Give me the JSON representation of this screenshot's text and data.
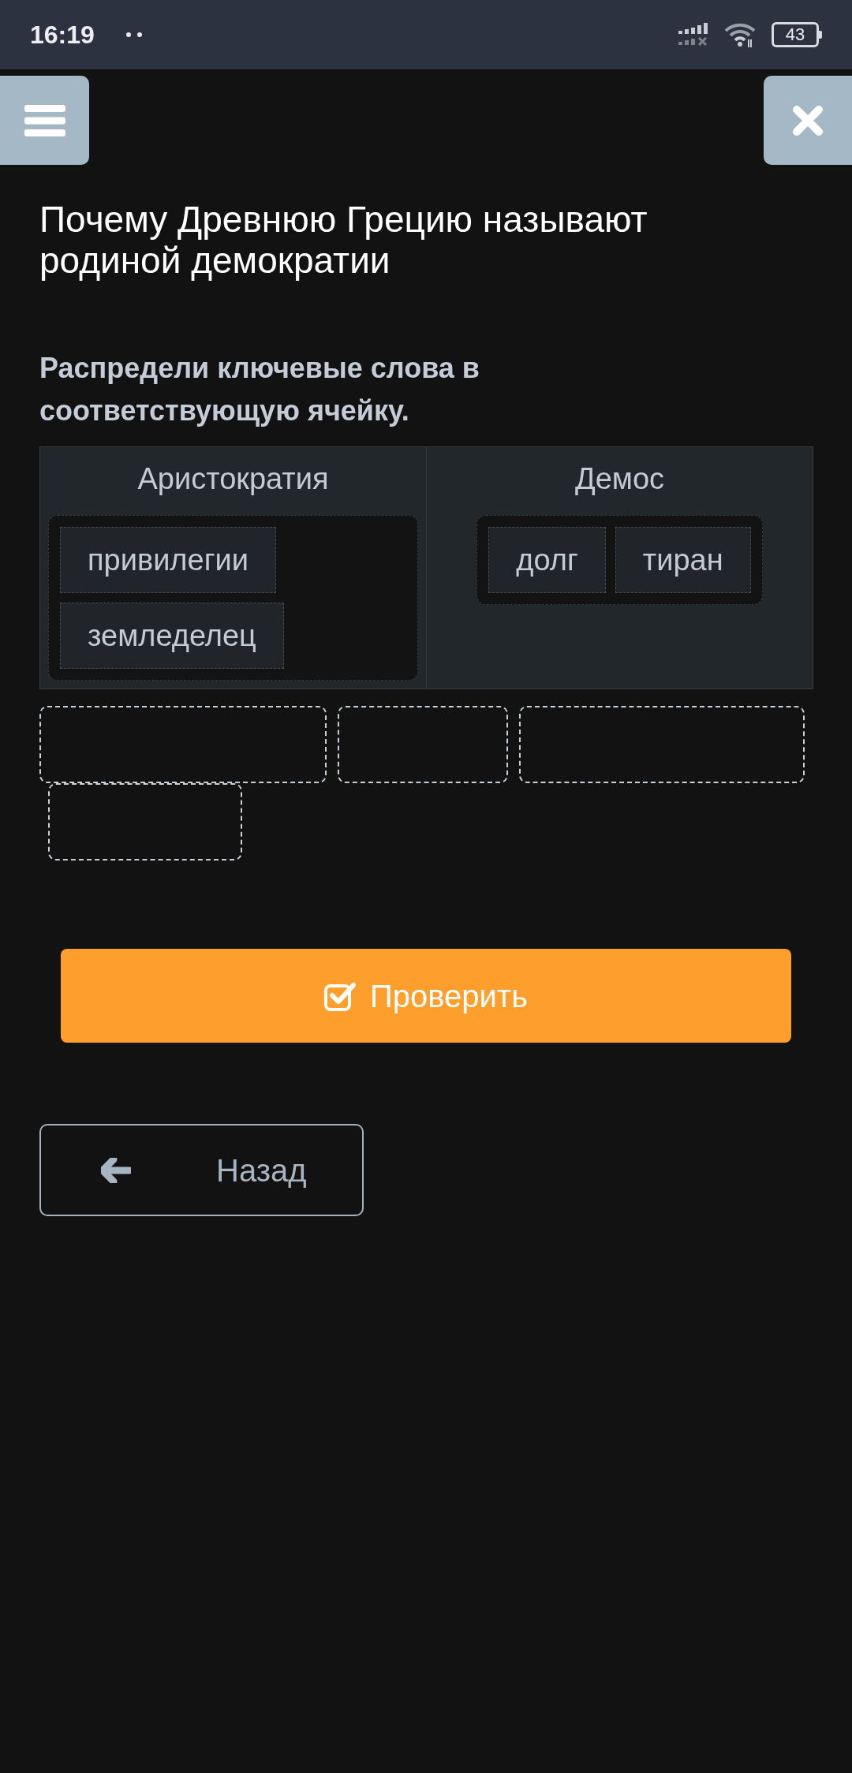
{
  "status_bar": {
    "time": "16:19",
    "battery": "43"
  },
  "title": "Почему Древнюю Грецию называют родиной демократии",
  "instruction": "Распредели ключевые слова в соответствующую ячейку.",
  "sorting_table": {
    "columns": [
      {
        "header": "Аристократия",
        "words": [
          "привилегии",
          "земледелец"
        ]
      },
      {
        "header": "Демос",
        "words": [
          "долг",
          "тиран"
        ]
      }
    ]
  },
  "answer_slots": [
    {
      "kind": "empty"
    },
    {
      "kind": "empty"
    },
    {
      "kind": "empty"
    },
    {
      "kind": "empty"
    }
  ],
  "check_button": {
    "label": "Проверить"
  },
  "back_button": {
    "label": "Назад"
  }
}
